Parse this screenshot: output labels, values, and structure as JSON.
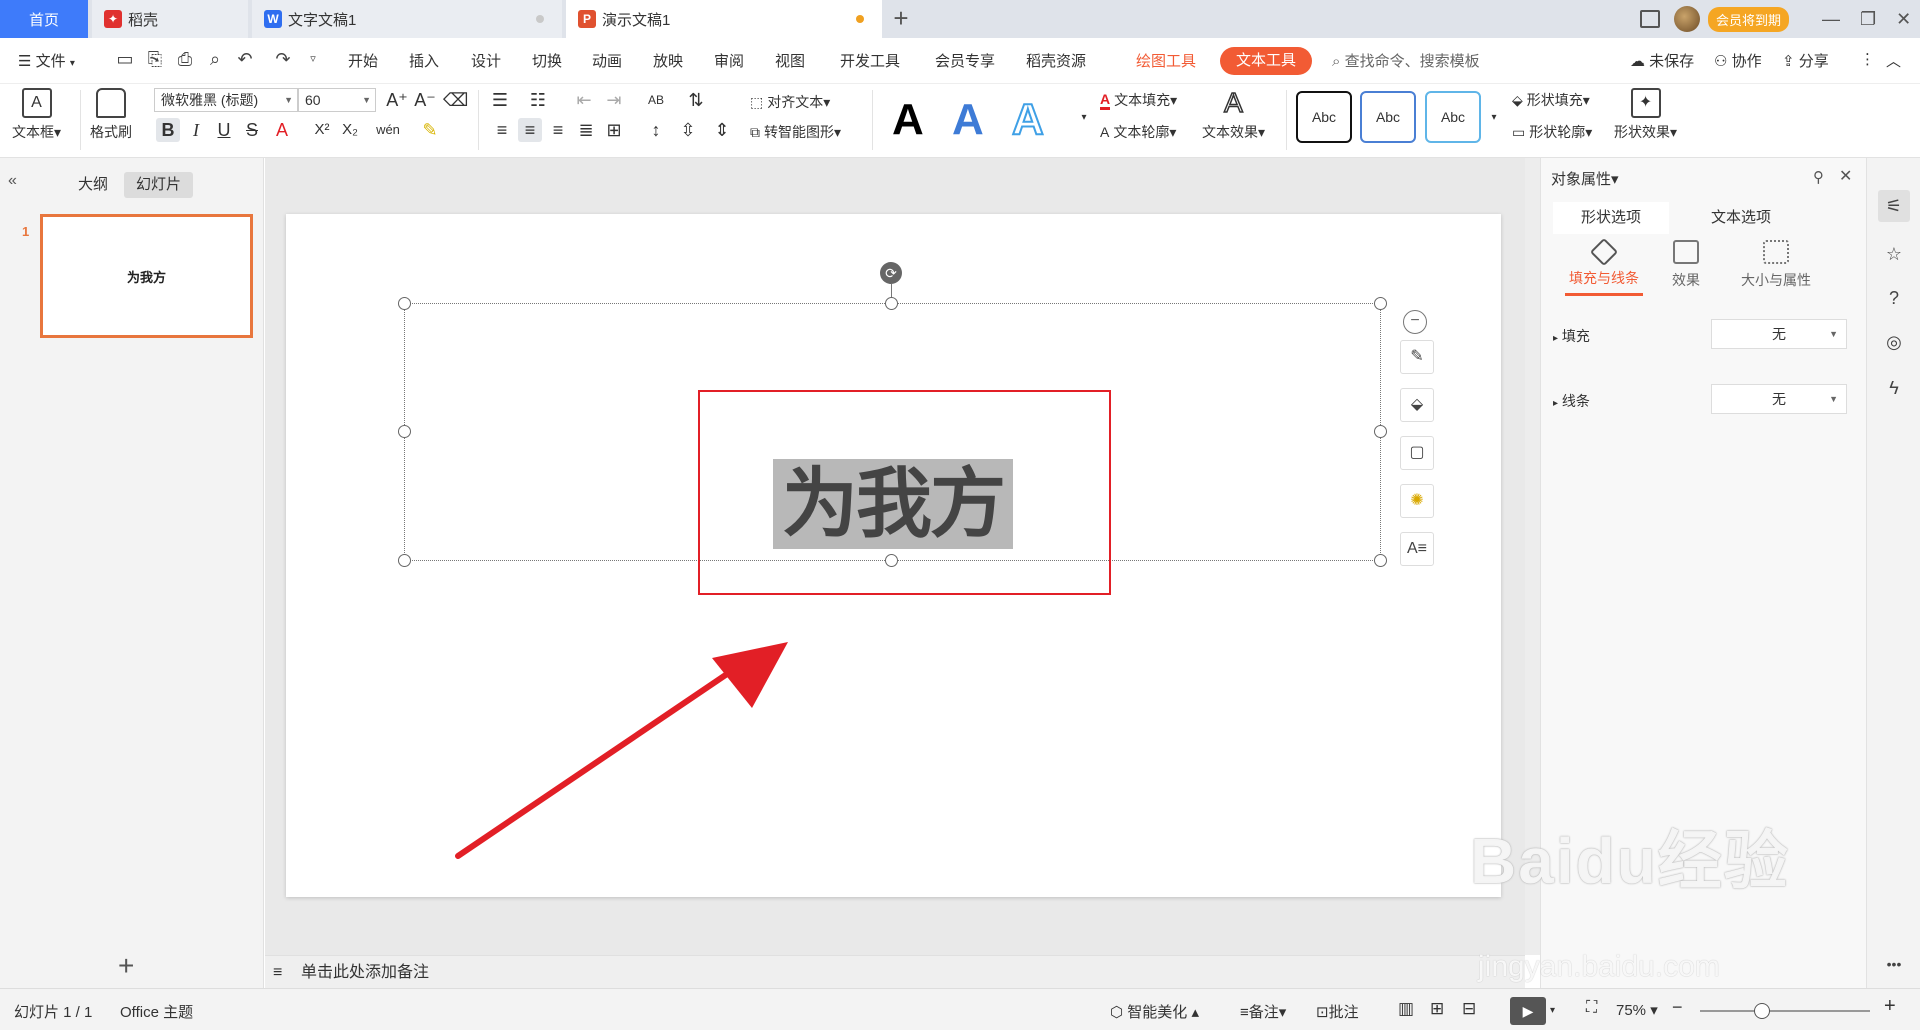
{
  "tabs": {
    "home": "首页",
    "daoke": "稻壳",
    "doc": "文字文稿1",
    "ppt": "演示文稿1"
  },
  "topright": {
    "vip": "会员将到期"
  },
  "menu": {
    "file": "文件",
    "items": [
      "开始",
      "插入",
      "设计",
      "切换",
      "动画",
      "放映",
      "审阅",
      "视图",
      "开发工具",
      "会员专享",
      "稻壳资源"
    ],
    "drawing_tools": "绘图工具",
    "text_tools": "文本工具",
    "search": "查找命令、搜索模板",
    "unsaved": "未保存",
    "collab": "协作",
    "share": "分享"
  },
  "ribbon": {
    "textbox": "文本框",
    "format_painter": "格式刷",
    "font": "微软雅黑 (标题)",
    "size": "60",
    "align_text": "对齐文本",
    "smart_shape": "转智能图形",
    "text_fill": "文本填充",
    "text_outline": "文本轮廓",
    "text_effect": "文本效果",
    "abc": [
      "Abc",
      "Abc",
      "Abc"
    ],
    "shape_fill": "形状填充",
    "shape_outline": "形状轮廓",
    "shape_effect": "形状效果",
    "big_a": [
      "A",
      "A",
      "A"
    ]
  },
  "left_panel": {
    "outline": "大纲",
    "slides": "幻灯片",
    "slide_num": "1",
    "thumb_text": "为我方"
  },
  "slide": {
    "text": "为我方"
  },
  "notes": "单击此处添加备注",
  "right_panel": {
    "title": "对象属性",
    "tab_shape": "形状选项",
    "tab_text": "文本选项",
    "sub_fill": "填充与线条",
    "sub_effect": "效果",
    "sub_size": "大小与属性",
    "fill_label": "填充",
    "fill_value": "无",
    "line_label": "线条",
    "line_value": "无"
  },
  "status": {
    "slide_info": "幻灯片 1 / 1",
    "theme": "Office 主题",
    "beautify": "智能美化",
    "notes": "备注",
    "comment": "批注",
    "zoom": "75%"
  },
  "watermark": {
    "main": "Baidu经验",
    "sub": "jingyan.baidu.com"
  },
  "colors": {
    "accent": "#f25b34",
    "home_tab": "#3e7bfa",
    "highlight_box": "#e21f26",
    "thumb_border": "#e8763d"
  }
}
